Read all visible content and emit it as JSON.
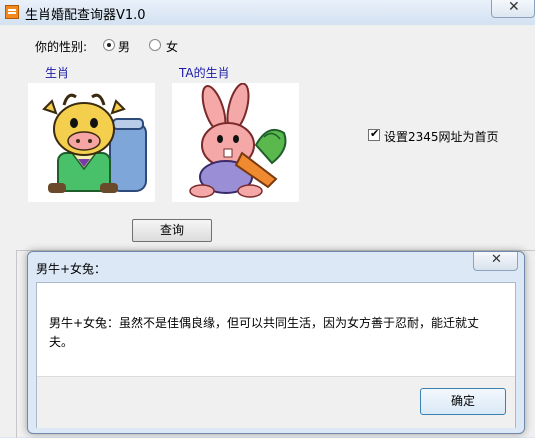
{
  "window": {
    "title": "生肖婚配查询器V1.0",
    "close_glyph": "✕"
  },
  "gender": {
    "label": "你的性别:",
    "options": [
      "男",
      "女"
    ],
    "selected": "男"
  },
  "zodiac": {
    "self_label": "生肖",
    "partner_label": "TA的生肖",
    "self_animal": "牛",
    "partner_animal": "兔"
  },
  "homepage": {
    "label": "设置2345网址为首页",
    "checked": true,
    "check_glyph": "✔"
  },
  "query_button": "查询",
  "dialog": {
    "title": "男牛+女兔：",
    "message": "男牛+女兔：虽然不是佳偶良缘，但可以共同生活，因为女方善于忍耐，能迁就丈夫。",
    "ok_label": "确定",
    "close_glyph": "✕"
  }
}
